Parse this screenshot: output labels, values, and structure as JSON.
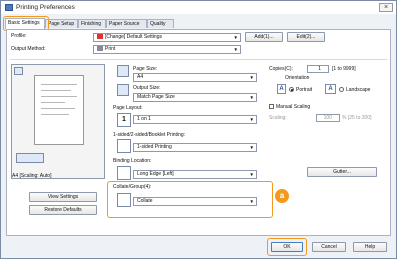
{
  "window": {
    "title": "Printing Preferences",
    "close_glyph": "×"
  },
  "tabs": [
    {
      "label": "Basic Settings"
    },
    {
      "label": "Page Setup"
    },
    {
      "label": "Finishing"
    },
    {
      "label": "Paper Source"
    },
    {
      "label": "Quality"
    }
  ],
  "profile": {
    "label": "Profile:",
    "value": "[Change] Default Settings",
    "add_button": "Add(1)...",
    "edit_button": "Edit(2)..."
  },
  "output_method": {
    "label": "Output Method:",
    "value": "Print"
  },
  "page_size": {
    "label": "Page Size:",
    "value": "A4"
  },
  "output_size": {
    "label": "Output Size:",
    "value": "Match Page Size"
  },
  "copies": {
    "label": "Copies(C):",
    "value": "1",
    "range": "[1 to 9999]"
  },
  "orientation": {
    "label": "Orientation",
    "portrait": "Portrait",
    "landscape": "Landscape"
  },
  "manual_scaling": {
    "label": "Manual Scaling",
    "scaling_label": "Scaling:",
    "scaling_value": "100",
    "scaling_range": "% [25 to 200]"
  },
  "page_layout": {
    "label": "Page Layout:",
    "value": "1 on 1",
    "icon_text": "1"
  },
  "print_style": {
    "label": "1-sided/2-sided/Booklet Printing:",
    "value": "1-sided Printing"
  },
  "binding": {
    "label": "Binding Location:",
    "value": "Long Edge [Left]",
    "gutter_button": "Gutter..."
  },
  "collate": {
    "label": "Collate/Group(4):",
    "value": "Collate"
  },
  "preview": {
    "caption": "A4 [Scaling: Auto]"
  },
  "left_buttons": {
    "view_settings": "View Settings",
    "restore_defaults": "Restore Defaults"
  },
  "footer": {
    "ok": "OK",
    "cancel": "Cancel",
    "help": "Help"
  },
  "callout": {
    "letter": "a"
  },
  "colors": {
    "highlight": "#f39a1e",
    "panel_border": "#a9b3c4",
    "window_bg": "#eef1f6"
  }
}
